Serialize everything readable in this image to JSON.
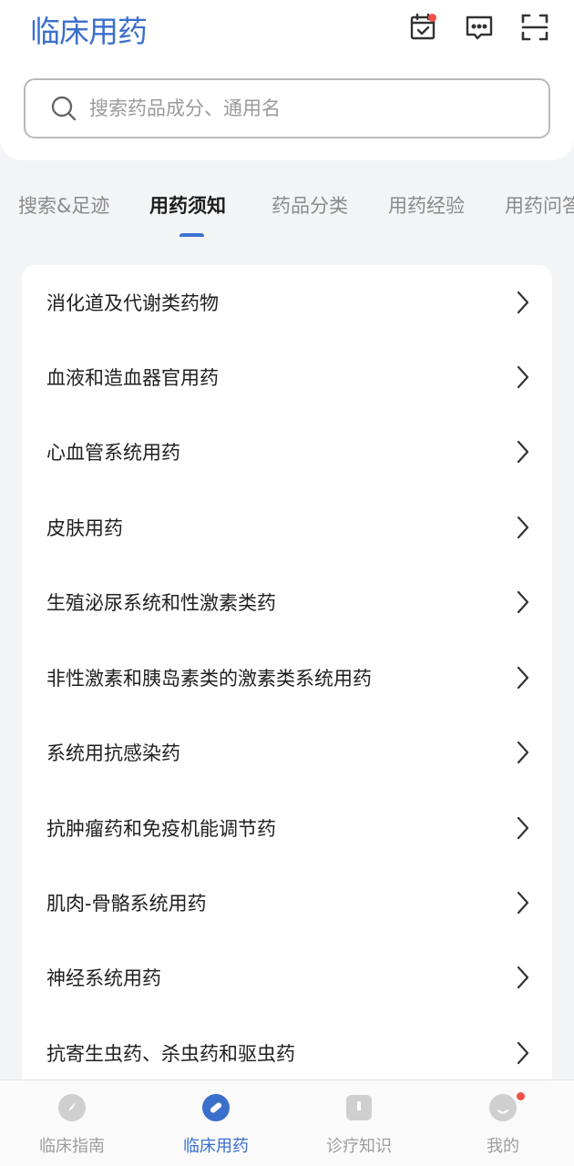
{
  "header": {
    "title": "临床用药",
    "icons": [
      "calendar-check-icon",
      "message-icon",
      "scan-icon"
    ],
    "notification_dot_color": "#f0504a"
  },
  "search": {
    "placeholder": "搜索药品成分、通用名",
    "value": ""
  },
  "tabs": [
    {
      "label": "搜索&足迹",
      "active": false
    },
    {
      "label": "用药须知",
      "active": true
    },
    {
      "label": "药品分类",
      "active": false
    },
    {
      "label": "用药经验",
      "active": false
    },
    {
      "label": "用药问答",
      "active": false
    }
  ],
  "categories": [
    "消化道及代谢类药物",
    "血液和造血器官用药",
    "心血管系统用药",
    "皮肤用药",
    "生殖泌尿系统和性激素类药",
    "非性激素和胰岛素类的激素类系统用药",
    "系统用抗感染药",
    "抗肿瘤药和免疫机能调节药",
    "肌肉-骨骼系统用药",
    "神经系统用药",
    "抗寄生虫药、杀虫药和驱虫药"
  ],
  "bottom_nav": [
    {
      "label": "临床指南",
      "icon": "compass-icon",
      "active": false
    },
    {
      "label": "临床用药",
      "icon": "pill-icon",
      "active": true
    },
    {
      "label": "诊疗知识",
      "icon": "book-icon",
      "active": false
    },
    {
      "label": "我的",
      "icon": "profile-icon",
      "active": false,
      "badge": true
    }
  ],
  "colors": {
    "accent": "#3a6fcb",
    "badge": "#f0504a",
    "text": "#1f1f1f",
    "muted": "#8a8a8a"
  }
}
